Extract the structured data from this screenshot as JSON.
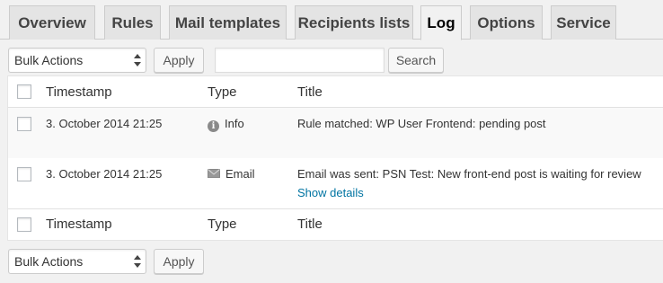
{
  "tabs": [
    {
      "label": "Overview",
      "active": false
    },
    {
      "label": "Rules",
      "active": false
    },
    {
      "label": "Mail templates",
      "active": false
    },
    {
      "label": "Recipients lists",
      "active": false
    },
    {
      "label": "Log",
      "active": true
    },
    {
      "label": "Options",
      "active": false
    },
    {
      "label": "Service",
      "active": false
    }
  ],
  "top_actions": {
    "bulk_select_value": "Bulk Actions",
    "apply_label": "Apply",
    "search_value": "",
    "search_button_label": "Search"
  },
  "table": {
    "columns": [
      "Timestamp",
      "Type",
      "Title"
    ],
    "rows": [
      {
        "timestamp": "3. October 2014 21:25",
        "type": "Info",
        "type_icon": "info-icon",
        "title": "Rule matched: WP User Frontend: pending post",
        "link": ""
      },
      {
        "timestamp": "3. October 2014 21:25",
        "type": "Email",
        "type_icon": "email-icon",
        "title": "Email was sent: PSN Test: New front-end post is waiting for review",
        "link": "Show details"
      }
    ]
  },
  "bottom_actions": {
    "bulk_select_value": "Bulk Actions",
    "apply_label": "Apply"
  },
  "colors": {
    "background": "#f1f1f1",
    "link": "#0074a2",
    "tab_inactive": "#e4e4e4"
  }
}
